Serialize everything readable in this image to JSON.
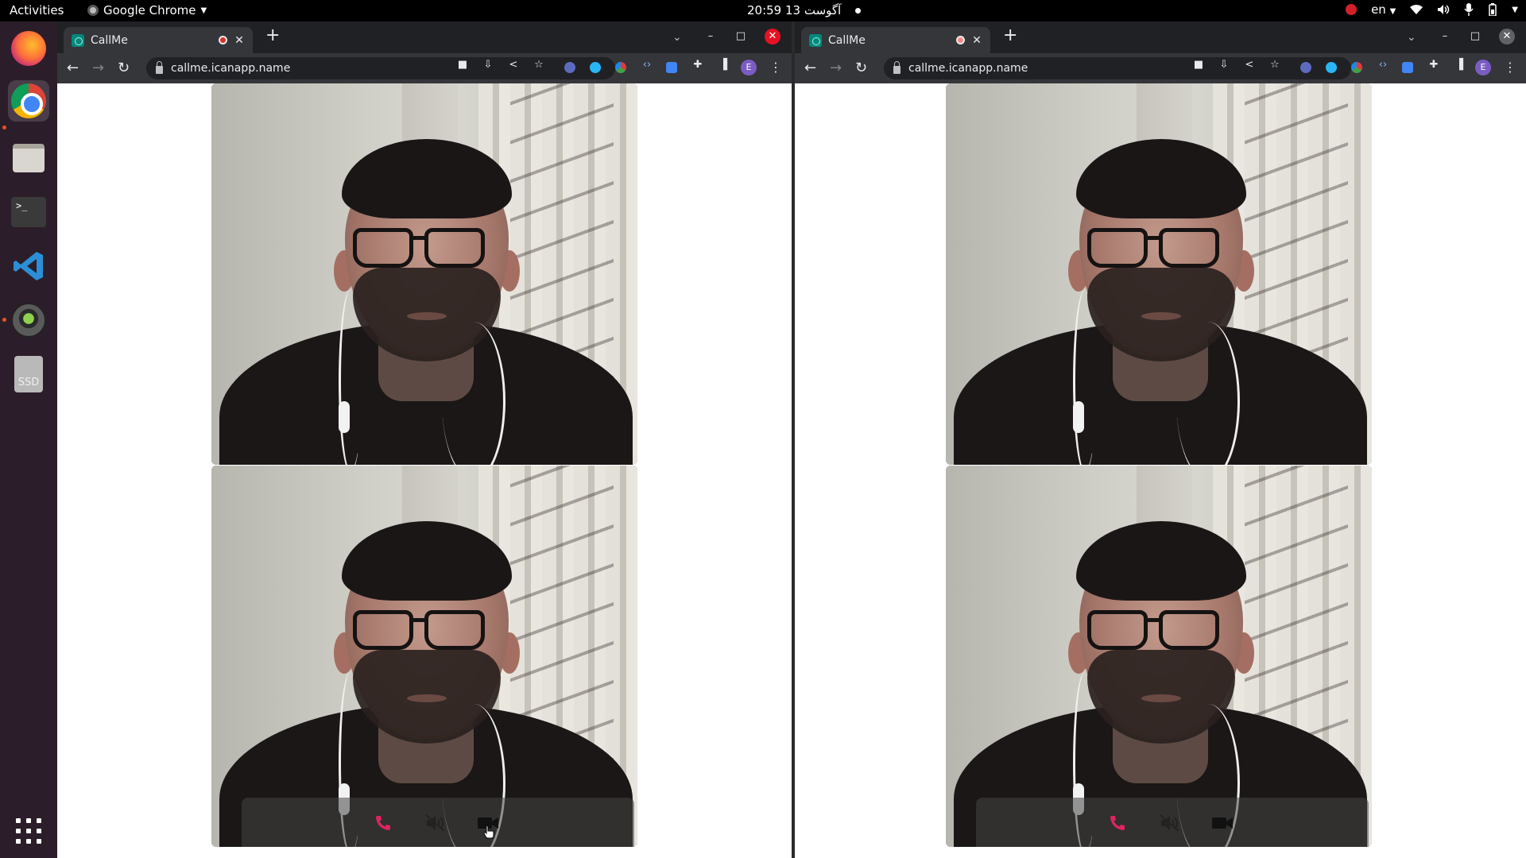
{
  "topbar": {
    "activities": "Activities",
    "app_name": "Google Chrome",
    "clock": "20:59  13 آگوست",
    "keyboard_layout": "en"
  },
  "dock": {
    "items": [
      "firefox-icon",
      "chrome-icon",
      "files-icon",
      "terminal-icon",
      "vscode-icon",
      "screenshot-icon",
      "ssd-drive-icon",
      "show-apps-icon"
    ],
    "terminal_glyph": ">_",
    "ssd_label": "SSD"
  },
  "windows": [
    {
      "tab_title": "CallMe",
      "url": "callme.icanapp.name",
      "profile_initial": "E",
      "recording_color": "#d93025"
    },
    {
      "tab_title": "CallMe",
      "url": "callme.icanapp.name",
      "profile_initial": "E",
      "recording_color": "#f28b82"
    }
  ],
  "colors": {
    "hangup": "#e0245e",
    "accent_record": "#d3202a",
    "close_red": "#e81123"
  }
}
